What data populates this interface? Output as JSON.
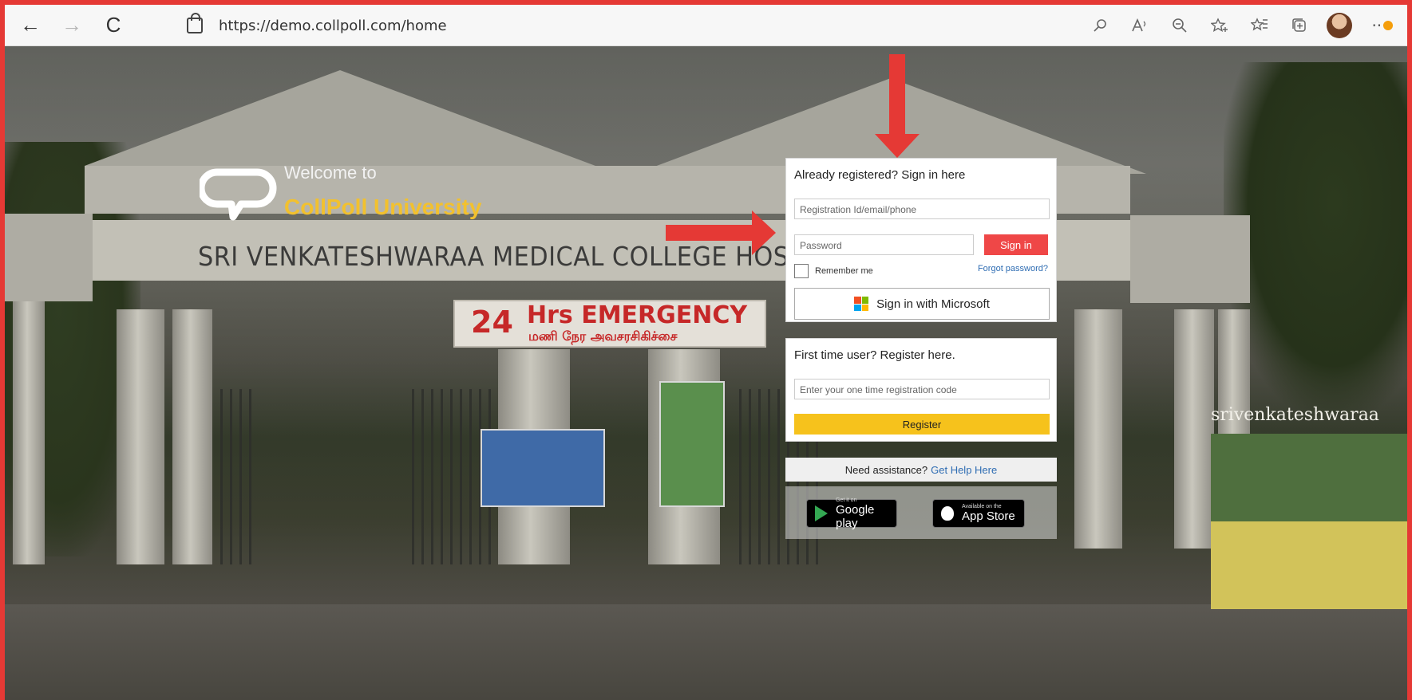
{
  "browser": {
    "url": "https://demo.collpoll.com/home",
    "back_icon": "←",
    "forward_icon": "→",
    "refresh_icon": "C",
    "tools": [
      "read-aloud-icon",
      "text-size-icon",
      "zoom-out-icon",
      "favorite-add-icon",
      "favorites-icon",
      "collections-icon",
      "profile-avatar",
      "more-icon"
    ]
  },
  "hero": {
    "welcome": "Welcome to",
    "university": "CollPoll University",
    "college_sign": "SRI VENKATESHWARAA MEDICAL COLLEGE HOSPITAL A",
    "emergency_num": "24",
    "emergency_text": "Hrs EMERGENCY",
    "emergency_tamil": "மணி நேர அவசரசிகிச்சை",
    "banner_title": "srivenkateshwaraa"
  },
  "signin": {
    "heading": "Already registered? Sign in here",
    "username_placeholder": "Registration Id/email/phone",
    "password_placeholder": "Password",
    "signin_label": "Sign in",
    "remember_label": "Remember me",
    "forgot_label": "Forgot password?",
    "microsoft_label": "Sign in with Microsoft"
  },
  "register": {
    "heading": "First time user? Register here.",
    "code_placeholder": "Enter your one time registration code",
    "register_label": "Register"
  },
  "assist": {
    "text": "Need assistance?",
    "link": "Get Help Here"
  },
  "stores": {
    "google_small": "Get it on",
    "google_name": "Google play",
    "apple_small": "Available on the",
    "apple_name": "App Store"
  },
  "colors": {
    "accent_red": "#ef4747",
    "register_yellow": "#f6c21c",
    "link_blue": "#2f6db3",
    "brand_yellow": "#f2c12e"
  }
}
